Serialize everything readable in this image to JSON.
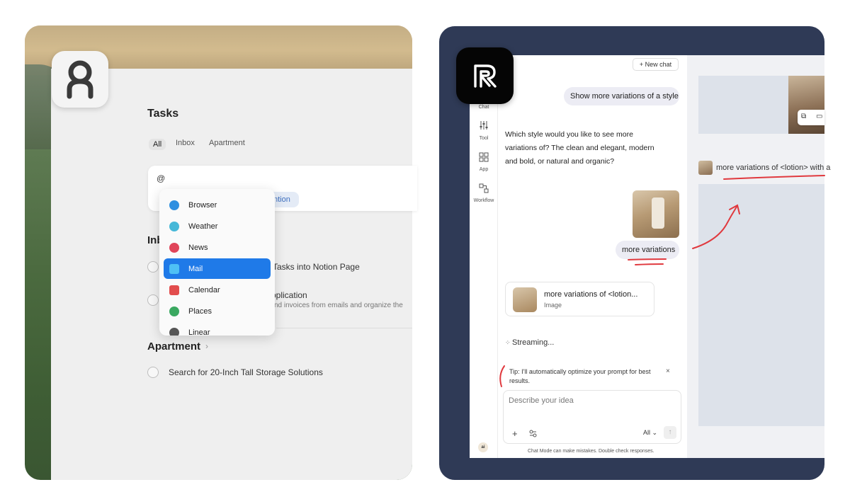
{
  "left_app": {
    "title": "Tasks",
    "tabs": [
      "All",
      "Inbox",
      "Apartment"
    ],
    "composer_value": "@",
    "mention_chip": "ntion",
    "dropdown_items": [
      {
        "label": "Browser",
        "color": "#2f8fe0"
      },
      {
        "label": "Weather",
        "color": "#46b8d8"
      },
      {
        "label": "News",
        "color": "#e0455a"
      },
      {
        "label": "Mail",
        "color": "#4ec0f5"
      },
      {
        "label": "Calendar",
        "color": "#e24d4d"
      },
      {
        "label": "Places",
        "color": "#3aa860"
      },
      {
        "label": "Linear",
        "color": "#555555"
      }
    ],
    "selected_item": "Mail",
    "inbox_heading": "Inb",
    "inbox_rows": [
      {
        "text": "Tasks into Notion Page",
        "sub": ""
      },
      {
        "text": "pplication",
        "sub": "nd invoices from emails and organize the"
      }
    ],
    "apartment_heading": "Apartment",
    "apartment_rows": [
      {
        "text": "Search for 20-Inch Tall Storage Solutions"
      }
    ]
  },
  "right_app": {
    "sidebar": [
      {
        "label": "Chat"
      },
      {
        "label": "Tool"
      },
      {
        "label": "App"
      },
      {
        "label": "Workflow"
      }
    ],
    "new_chat": "New chat",
    "user_message_1": "Show more variations of a style",
    "assistant_message": "Which style would you like to see more variations of? The clean and elegant, modern and bold, or natural and organic?",
    "user_message_2": "more variations",
    "result_card": {
      "title": "more variations of <lotion...",
      "subtitle": "Image"
    },
    "streaming": "Streaming...",
    "tip": "Tip: I'll automatically optimize your prompt for best results.",
    "tip_close": "×",
    "input_placeholder": "Describe your idea",
    "mode_select": "All",
    "disclaimer": "Chat Mode can make mistakes. Double check responses.",
    "ai_badge": "ai",
    "prompt_preview": "more variations of <lotion> with a"
  },
  "colors": {
    "right_frame": "#2f3a56",
    "selected": "#1f7ae8",
    "annotation": "#e0393e"
  }
}
